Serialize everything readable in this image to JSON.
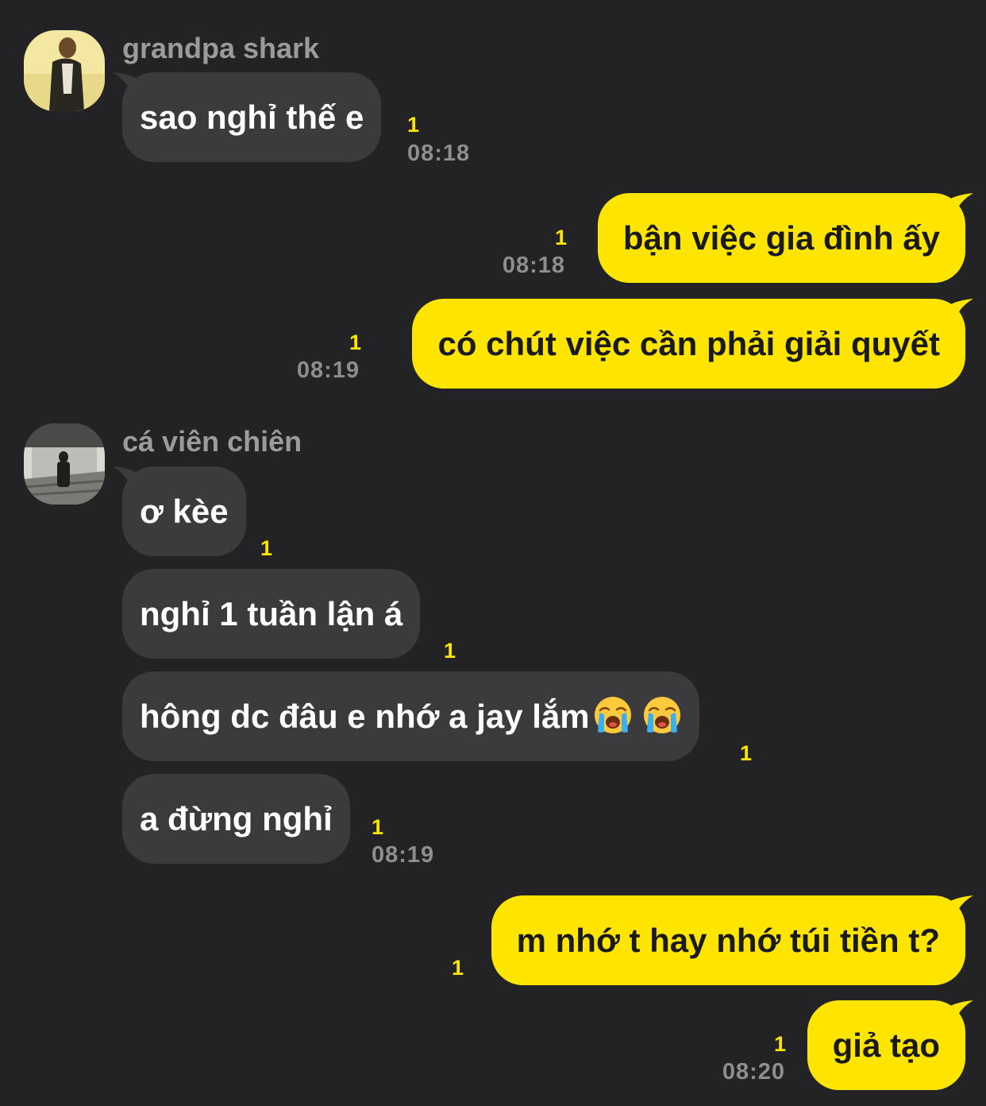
{
  "colors": {
    "background": "#232325",
    "incoming_bubble": "#3b3b3d",
    "outgoing_bubble": "#fee500",
    "unread_count": "#fee500",
    "timestamp": "#8e8e8e",
    "sender_name": "#9b9b9b"
  },
  "messages": [
    {
      "sender": "grandpa shark",
      "avatar_icon": "profile-photo",
      "bubbles": [
        {
          "text": "sao nghỉ thế e",
          "unread": "1",
          "time": "08:18"
        }
      ]
    },
    {
      "sender": "me",
      "bubbles": [
        {
          "text": "bận việc gia đình ấy",
          "unread": "1",
          "time": "08:18"
        },
        {
          "text": "có chút việc cần phải giải quyết",
          "unread": "1",
          "time": "08:19"
        }
      ]
    },
    {
      "sender": "cá viên chiên",
      "avatar_icon": "profile-photo",
      "bubbles": [
        {
          "text": "ơ kèe",
          "unread": "1"
        },
        {
          "text": "nghỉ 1 tuần lận á",
          "unread": "1"
        },
        {
          "text": "hông dc đâu e nhớ a jay lắm",
          "emoji": "loudly-crying-face-icon",
          "unread": "1"
        },
        {
          "text": "a đừng nghỉ",
          "unread": "1",
          "time": "08:19"
        }
      ]
    },
    {
      "sender": "me",
      "bubbles": [
        {
          "text": "m nhớ t hay nhớ túi tiền t?",
          "unread": "1"
        },
        {
          "text": "giả tạo",
          "unread": "1",
          "time": "08:20"
        }
      ]
    }
  ]
}
